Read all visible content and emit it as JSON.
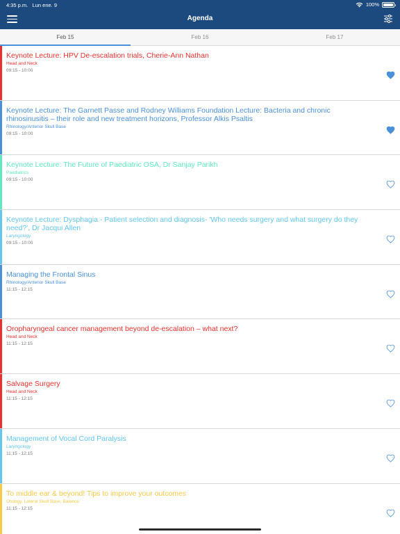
{
  "status_bar": {
    "time": "4:35 p.m.",
    "date": "Lun ene. 9",
    "battery": "100%",
    "battery_level": 1.0
  },
  "header": {
    "title": "Agenda"
  },
  "tabs": [
    {
      "label": "Feb 15",
      "active": true
    },
    {
      "label": "Feb 16",
      "active": false
    },
    {
      "label": "Feb 17",
      "active": false
    }
  ],
  "sessions": [
    {
      "title": "Keynote Lecture: HPV De-escalation trials, Cherie-Ann Nathan",
      "category": "Head and Neck",
      "time": "09:15 - 10:00",
      "color": "#e8302e",
      "favorite": true
    },
    {
      "title": "Keynote Lecture: The Garnett Passe and Rodney Williams Foundation Lecture: Bacteria and chronic rhinosinusitis – their role and new  treatment horizons,  Professor Alkis Psaltis",
      "category": "Rhinology/Anterior Skull Base",
      "time": "09:15 - 10:00",
      "color": "#4a90d9",
      "favorite": true
    },
    {
      "title": "Keynote Lecture: The Future of Paediatric OSA, Dr Sanjay Parikh",
      "category": "Paediatrics",
      "time": "09:15 - 10:00",
      "color": "#5ee8c0",
      "favorite": false
    },
    {
      "title": "Keynote Lecture: Dysphagia - Patient selection and diagnosis- 'Who needs surgery and what surgery do they need?', Dr Jacqui Allen",
      "category": "Laryngology",
      "time": "09:15 - 10:00",
      "color": "#62c6ee",
      "favorite": false
    },
    {
      "title": "Managing the Frontal Sinus",
      "category": "Rhinology/Anterior Skull Base",
      "time": "11:15 - 12:15",
      "color": "#4a90d9",
      "favorite": false
    },
    {
      "title": "Oropharyngeal cancer management beyond de-escalation – what next?",
      "category": "Head and Neck",
      "time": "11:15 - 12:15",
      "color": "#e8302e",
      "favorite": false
    },
    {
      "title": "Salvage Surgery",
      "category": "Head and Neck",
      "time": "11:15 - 12:15",
      "color": "#e8302e",
      "favorite": false
    },
    {
      "title": "Management of Vocal Cord Paralysis",
      "category": "Laryngology",
      "time": "11:15 - 12:15",
      "color": "#62c6ee",
      "favorite": false
    },
    {
      "title": "To middle ear & beyond! Tips to improve your outcomes",
      "category": "Otology, Lateral Skull Base, Balance",
      "time": "11:15 - 12:15",
      "color": "#f7c948",
      "favorite": false
    }
  ],
  "colors": {
    "header_bg": "#1c4a7e",
    "tab_indicator": "#4a90d9",
    "favorite_icon": "#4a90d9"
  },
  "icons": {
    "menu": "hamburger-menu-icon",
    "filter": "sliders-filter-icon",
    "favorite_filled": "heart-filled-icon",
    "favorite_outline": "heart-outline-icon",
    "wifi": "wifi-icon",
    "battery": "battery-icon"
  }
}
